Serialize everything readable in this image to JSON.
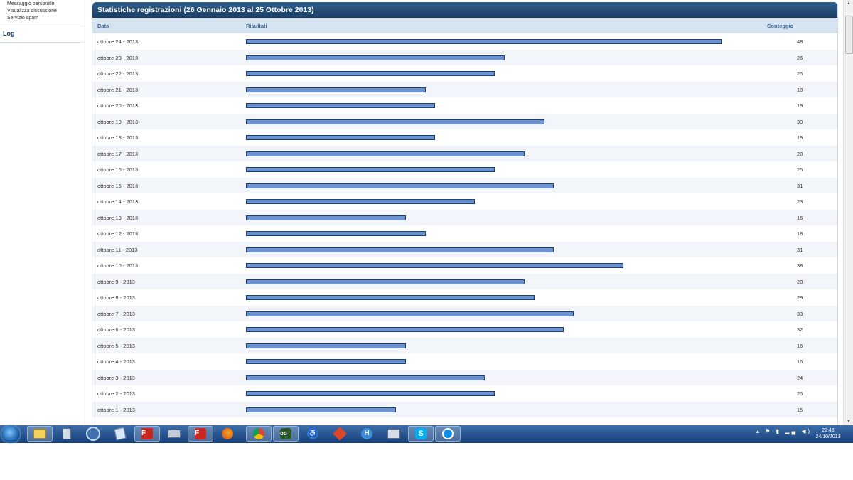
{
  "sidebar": {
    "links": [
      "Messaggio personale",
      "Visualizza discussione",
      "Servizio spam"
    ],
    "section": "Log"
  },
  "panel": {
    "title": "Statistiche registrazioni (26 Gennaio 2013 al 25 Ottobre 2013)",
    "columns": {
      "date": "Data",
      "results": "Risultati",
      "count": "Conteggio"
    }
  },
  "chart_data": {
    "type": "bar",
    "orientation": "horizontal",
    "title": "Statistiche registrazioni (26 Gennaio 2013 al 25 Ottobre 2013)",
    "categories": [
      "ottobre 24 - 2013",
      "ottobre 23 - 2013",
      "ottobre 22 - 2013",
      "ottobre 21 - 2013",
      "ottobre 20 - 2013",
      "ottobre 19 - 2013",
      "ottobre 18 - 2013",
      "ottobre 17 - 2013",
      "ottobre 16 - 2013",
      "ottobre 15 - 2013",
      "ottobre 14 - 2013",
      "ottobre 13 - 2013",
      "ottobre 12 - 2013",
      "ottobre 11 - 2013",
      "ottobre 10 - 2013",
      "ottobre 9 - 2013",
      "ottobre 8 - 2013",
      "ottobre 7 - 2013",
      "ottobre 6 - 2013",
      "ottobre 5 - 2013",
      "ottobre 4 - 2013",
      "ottobre 3 - 2013",
      "ottobre 2 - 2013",
      "ottobre 1 - 2013"
    ],
    "values": [
      48,
      26,
      25,
      18,
      19,
      30,
      19,
      28,
      25,
      31,
      23,
      16,
      18,
      31,
      38,
      28,
      29,
      33,
      32,
      16,
      16,
      24,
      25,
      15
    ],
    "bar_color": "#6b93cf",
    "max_value": 48
  },
  "taskbar": {
    "apps": [
      "start-button",
      "file-explorer-icon",
      "calculator-icon",
      "thunderbird-icon",
      "notepad-icon",
      "filezilla-icon",
      "printer-icon",
      "filezilla-red-icon",
      "firefox-icon",
      "chrome-icon",
      "owl-icon",
      "accessibility-icon",
      "app-icon",
      "h-icon",
      "network-icon",
      "skype-icon",
      "teamviewer-icon"
    ],
    "tray_icons": [
      "show-hidden-icon",
      "flag-icon",
      "battery-icon",
      "signal-icon",
      "volume-icon"
    ],
    "time": "22:46",
    "date": "24/10/2013"
  },
  "colors": {
    "header": "#1b3e63",
    "thead": "#d6e4f1",
    "row_alt": "#f2f5f9",
    "taskbar": "#17407a"
  }
}
